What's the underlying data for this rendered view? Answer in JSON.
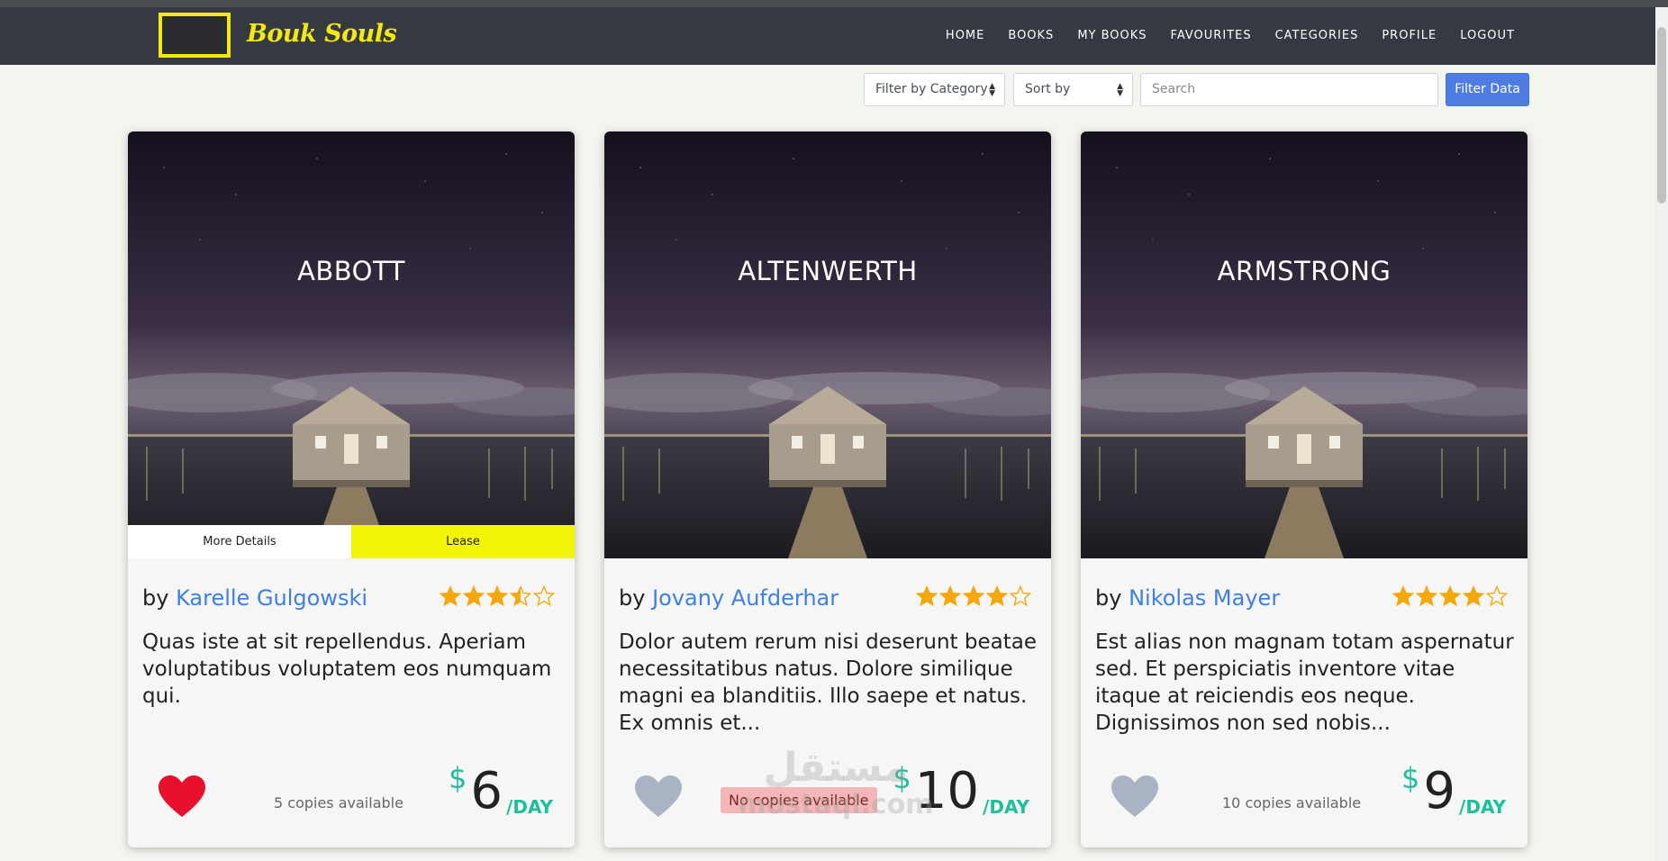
{
  "brand": {
    "name": "Bouk Souls"
  },
  "nav": {
    "items": [
      "HOME",
      "BOOKS",
      "MY BOOKS",
      "FAVOURITES",
      "CATEGORIES",
      "PROFILE",
      "LOGOUT"
    ]
  },
  "filters": {
    "category_label": "Filter by Category",
    "sort_label": "Sort by",
    "search_placeholder": "Search",
    "filter_button": "Filter Data"
  },
  "colors": {
    "accent_yellow": "#f4e812",
    "link_blue": "#3f7fe0",
    "price_green": "#1fbf9a",
    "heart_red": "#e8102c",
    "heart_grey": "#a9b3c4"
  },
  "cards": [
    {
      "title": "ABBOTT",
      "by": "by",
      "author": "Karelle Gulgowski",
      "rating": 3.5,
      "description": "Quas iste at sit repellendus. Aperiam voluptatibus voluptatem eos numquam qui.",
      "favourite": true,
      "copies": "5 copies available",
      "copies_none": false,
      "currency": "$",
      "price": "6",
      "per": "/DAY",
      "more_details": "More Details",
      "lease": "Lease",
      "show_actions": true
    },
    {
      "title": "ALTENWERTH",
      "by": "by",
      "author": "Jovany Aufderhar",
      "rating": 4,
      "description": "Dolor autem rerum nisi deserunt beatae necessitatibus natus. Dolore similique magni ea blanditiis. Illo saepe et natus. Ex omnis et...",
      "favourite": false,
      "copies": "No copies available",
      "copies_none": true,
      "currency": "$",
      "price": "10",
      "per": "/DAY",
      "show_actions": false
    },
    {
      "title": "ARMSTRONG",
      "by": "by",
      "author": "Nikolas Mayer",
      "rating": 4,
      "description": "Est alias non magnam totam aspernatur sed. Et perspiciatis inventore vitae itaque at reiciendis eos neque. Dignissimos non sed nobis...",
      "favourite": false,
      "copies": "10 copies available",
      "copies_none": false,
      "currency": "$",
      "price": "9",
      "per": "/DAY",
      "show_actions": false
    }
  ],
  "watermark": {
    "line1": "مستقل",
    "line2": "mostaql.com"
  }
}
